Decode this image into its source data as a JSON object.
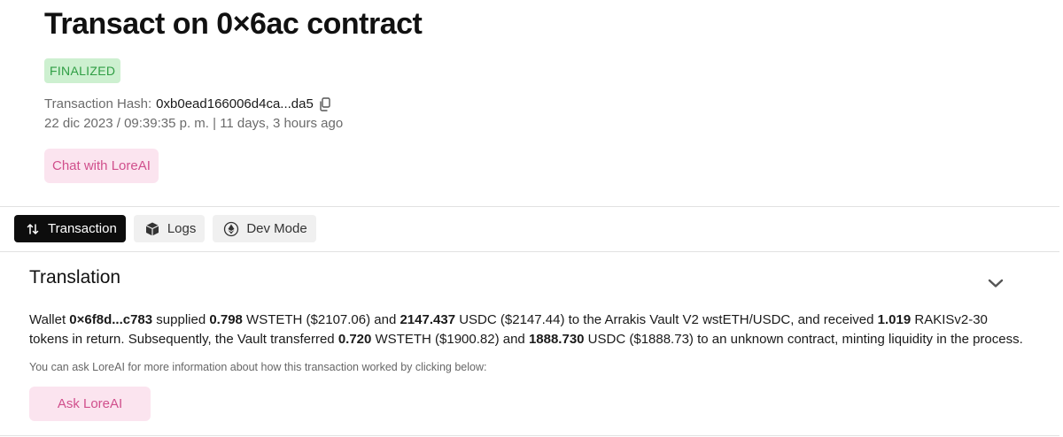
{
  "header": {
    "title": "Transact on 0×6ac contract",
    "status_badge": "FINALIZED",
    "hash_label": "Transaction Hash:",
    "hash_value": "0xb0ead166006d4ca...da5",
    "copy_icon": "copy-icon",
    "datetime": "22 dic 2023 / 09:39:35 p. m. | 11 days, 3 hours ago",
    "chat_button": "Chat with LoreAI"
  },
  "tabs": [
    {
      "label": "Transaction",
      "icon": "swap-arrows-icon",
      "active": true
    },
    {
      "label": "Logs",
      "icon": "cube-icon",
      "active": false
    },
    {
      "label": "Dev Mode",
      "icon": "ethereum-icon",
      "active": false
    }
  ],
  "translation_section": {
    "title": "Translation",
    "toggle_icon": "chevron-down-icon",
    "paragraph": [
      {
        "text": "Wallet ",
        "bold": false
      },
      {
        "text": "0×6f8d...c783",
        "bold": true
      },
      {
        "text": " supplied ",
        "bold": false
      },
      {
        "text": "0.798",
        "bold": true
      },
      {
        "text": " WSTETH ($2107.06) and ",
        "bold": false
      },
      {
        "text": "2147.437",
        "bold": true
      },
      {
        "text": " USDC ($2147.44) to the Arrakis Vault V2 wstETH/USDC, and received ",
        "bold": false
      },
      {
        "text": "1.019",
        "bold": true
      },
      {
        "text": " RAKISv2-30 tokens in return. Subsequently, the Vault transferred ",
        "bold": false
      },
      {
        "text": "0.720",
        "bold": true
      },
      {
        "text": " WSTETH ($1900.82) and ",
        "bold": false
      },
      {
        "text": "1888.730",
        "bold": true
      },
      {
        "text": " USDC ($1888.73) to an unknown contract, minting liquidity in the process.",
        "bold": false
      }
    ],
    "hint": "You can ask LoreAI for more information about how this transaction worked by clicking below:",
    "ask_button": "Ask LoreAI"
  },
  "colors": {
    "badge_bg": "#cdf0d0",
    "badge_text": "#2f9e44",
    "pink_bg": "#fbe4ef",
    "pink_text": "#d04f8c",
    "active_tab_bg": "#0d0d0d"
  }
}
